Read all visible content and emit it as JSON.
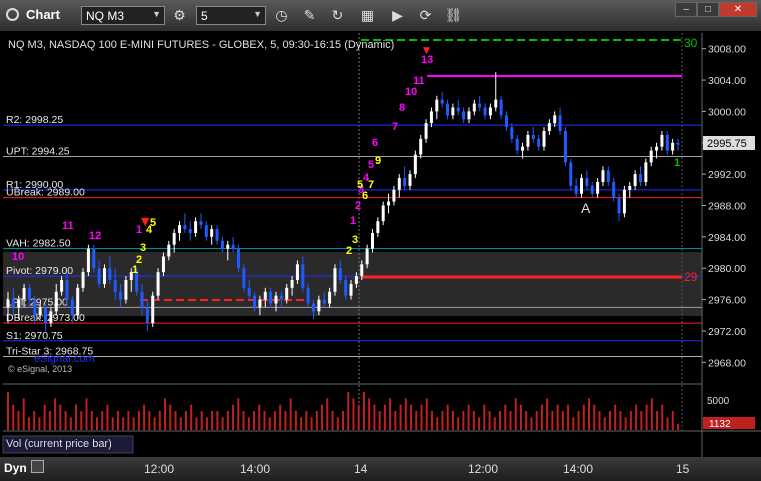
{
  "window": {
    "app_title": "Chart"
  },
  "toolbar": {
    "symbol": "NQ M3",
    "interval": "5"
  },
  "colors": {
    "magenta": "#ff00ff",
    "yellow": "#ffff00",
    "red": "#ff2020",
    "blue": "#2030ff",
    "green": "#00c000",
    "white": "#e0e0e0",
    "candle_up": "#ffffff",
    "candle_down": "#1f5bff",
    "pivot_zone": "#2a2a2a"
  },
  "chart": {
    "title": "NQ M3, NASDAQ 100 E-MINI FUTURES - GLOBEX, 5, 09:30-16:15 (Dynamic)",
    "copyright": "© eSignal, 2013",
    "watermark": "eSignal.com",
    "label_right_top": "30",
    "label_right_mid": "29",
    "letter_a": "A",
    "price_lines": [
      {
        "label": "R2: 2998.25",
        "price": 2998.25,
        "color": "#2030ff"
      },
      {
        "label": "UPT: 2994.25",
        "price": 2994.25,
        "color": "#a0a0a0"
      },
      {
        "label": "R1: 2990.00",
        "price": 2990.0,
        "color": "#2030ff"
      },
      {
        "label": "UBreak: 2989.00",
        "price": 2989.0,
        "color": "#ff2020"
      },
      {
        "label": "VAH: 2982.50",
        "price": 2982.5,
        "color": "#00a0a0"
      },
      {
        "label": "Pivot: 2979.00",
        "price": 2979.0,
        "color": "#2030ff"
      },
      {
        "label": "LPT: 2975.00",
        "price": 2975.0,
        "color": "#a0a0a0"
      },
      {
        "label": "DBreak: 2973.00",
        "price": 2973.0,
        "color": "#ff2020"
      },
      {
        "label": "S1: 2970.75",
        "price": 2970.75,
        "color": "#2030ff"
      },
      {
        "label": "Tri-Star 3: 2968.75",
        "price": 2968.75,
        "color": "#b0b0b0"
      }
    ],
    "price_axis": {
      "ticks": [
        "3008.00",
        "3004.00",
        "3000.00",
        "2996.00",
        "2992.00",
        "2988.00",
        "2984.00",
        "2980.00",
        "2976.00",
        "2972.00",
        "2968.00"
      ],
      "min": 2966,
      "max": 3010,
      "current_price": "2995.75"
    },
    "time_axis": {
      "labels": [
        "12:00",
        "14:00",
        "14",
        "12:00",
        "14:00",
        "15"
      ]
    },
    "volume_panel": {
      "label": "Vol (current price bar)",
      "axis_label": "5000",
      "current_value": "1132"
    },
    "bottom": {
      "mode": "Dyn"
    }
  },
  "chart_data": {
    "type": "candlestick",
    "title": "NQ M3, NASDAQ 100 E-MINI FUTURES - GLOBEX, 5, 09:30-16:15 (Dynamic)",
    "ylim": [
      2966,
      3010
    ],
    "series": [
      {
        "name": "price",
        "values": [
          [
            2975.0,
            2977.0,
            2973.0,
            2976.0
          ],
          [
            2976.0,
            2977.5,
            2974.0,
            2975.0
          ],
          [
            2975.0,
            2976.5,
            2973.5,
            2976.0
          ],
          [
            2976.0,
            2978.0,
            2975.0,
            2977.5
          ],
          [
            2977.5,
            2978.0,
            2975.0,
            2976.0
          ],
          [
            2976.0,
            2976.5,
            2973.0,
            2974.0
          ],
          [
            2974.0,
            2975.5,
            2973.5,
            2975.0
          ],
          [
            2975.0,
            2975.5,
            2972.0,
            2973.0
          ],
          [
            2973.0,
            2975.0,
            2972.5,
            2974.5
          ],
          [
            2974.5,
            2978.0,
            2974.0,
            2977.0
          ],
          [
            2977.0,
            2979.0,
            2976.5,
            2978.5
          ],
          [
            2978.5,
            2979.5,
            2975.0,
            2976.0
          ],
          [
            2976.0,
            2976.5,
            2973.0,
            2974.0
          ],
          [
            2974.0,
            2978.0,
            2973.5,
            2977.5
          ],
          [
            2977.5,
            2980.0,
            2977.0,
            2979.5
          ],
          [
            2979.5,
            2983.0,
            2979.0,
            2982.5
          ],
          [
            2982.5,
            2983.0,
            2979.5,
            2980.0
          ],
          [
            2980.0,
            2981.0,
            2977.5,
            2978.0
          ],
          [
            2978.0,
            2980.5,
            2977.5,
            2980.0
          ],
          [
            2980.0,
            2981.5,
            2978.0,
            2978.5
          ],
          [
            2978.5,
            2980.0,
            2976.0,
            2977.0
          ],
          [
            2977.0,
            2978.0,
            2975.0,
            2976.0
          ],
          [
            2976.0,
            2979.0,
            2975.5,
            2978.5
          ],
          [
            2978.5,
            2980.0,
            2977.0,
            2979.5
          ],
          [
            2979.5,
            2980.0,
            2976.5,
            2977.0
          ],
          [
            2977.0,
            2978.0,
            2974.0,
            2975.0
          ],
          [
            2975.0,
            2976.0,
            2972.0,
            2973.0
          ],
          [
            2973.0,
            2977.0,
            2972.5,
            2976.5
          ],
          [
            2976.5,
            2980.0,
            2976.0,
            2979.5
          ],
          [
            2979.5,
            2982.0,
            2979.0,
            2981.5
          ],
          [
            2981.5,
            2983.5,
            2981.0,
            2983.0
          ],
          [
            2983.0,
            2985.0,
            2982.0,
            2984.5
          ],
          [
            2984.5,
            2986.0,
            2983.5,
            2985.5
          ],
          [
            2985.5,
            2987.0,
            2984.5,
            2985.0
          ],
          [
            2985.0,
            2986.0,
            2983.5,
            2984.5
          ],
          [
            2984.5,
            2986.5,
            2984.0,
            2986.0
          ],
          [
            2986.0,
            2987.0,
            2985.0,
            2985.5
          ],
          [
            2985.5,
            2986.0,
            2983.5,
            2984.0
          ],
          [
            2984.0,
            2985.5,
            2983.0,
            2985.0
          ],
          [
            2985.0,
            2985.5,
            2983.0,
            2983.5
          ],
          [
            2983.5,
            2984.0,
            2982.0,
            2982.5
          ],
          [
            2982.5,
            2983.5,
            2981.0,
            2983.0
          ],
          [
            2983.0,
            2984.0,
            2982.0,
            2982.5
          ],
          [
            2982.5,
            2983.0,
            2979.5,
            2980.0
          ],
          [
            2980.0,
            2980.5,
            2977.0,
            2977.5
          ],
          [
            2977.5,
            2978.5,
            2976.0,
            2976.5
          ],
          [
            2976.5,
            2977.0,
            2974.5,
            2975.0
          ],
          [
            2975.0,
            2976.5,
            2974.0,
            2976.0
          ],
          [
            2976.0,
            2977.5,
            2975.0,
            2977.0
          ],
          [
            2977.0,
            2977.5,
            2975.0,
            2975.5
          ],
          [
            2975.5,
            2977.0,
            2974.5,
            2976.5
          ],
          [
            2976.5,
            2977.0,
            2975.0,
            2976.0
          ],
          [
            2976.0,
            2978.0,
            2975.5,
            2977.5
          ],
          [
            2977.5,
            2979.0,
            2976.5,
            2978.5
          ],
          [
            2978.5,
            2981.0,
            2978.0,
            2980.5
          ],
          [
            2980.5,
            2981.5,
            2977.0,
            2977.5
          ],
          [
            2977.5,
            2978.0,
            2975.0,
            2975.5
          ],
          [
            2975.5,
            2976.0,
            2973.5,
            2974.5
          ],
          [
            2974.5,
            2976.5,
            2974.0,
            2976.0
          ],
          [
            2976.0,
            2977.0,
            2975.0,
            2975.5
          ],
          [
            2975.5,
            2977.5,
            2975.0,
            2977.0
          ],
          [
            2977.0,
            2980.5,
            2976.5,
            2980.0
          ],
          [
            2980.0,
            2981.0,
            2978.0,
            2978.5
          ],
          [
            2978.5,
            2979.0,
            2976.0,
            2976.5
          ],
          [
            2976.5,
            2978.5,
            2976.0,
            2978.0
          ],
          [
            2978.0,
            2979.5,
            2977.5,
            2979.0
          ],
          [
            2979.0,
            2981.0,
            2978.5,
            2980.5
          ],
          [
            2980.5,
            2983.0,
            2980.0,
            2982.5
          ],
          [
            2982.5,
            2985.0,
            2982.0,
            2984.5
          ],
          [
            2984.5,
            2986.5,
            2984.0,
            2986.0
          ],
          [
            2986.0,
            2988.5,
            2985.5,
            2988.0
          ],
          [
            2988.0,
            2989.5,
            2987.0,
            2988.5
          ],
          [
            2988.5,
            2990.5,
            2988.0,
            2990.0
          ],
          [
            2990.0,
            2992.0,
            2989.0,
            2991.5
          ],
          [
            2991.5,
            2993.0,
            2990.0,
            2990.5
          ],
          [
            2990.5,
            2992.5,
            2990.0,
            2992.0
          ],
          [
            2992.0,
            2995.0,
            2991.5,
            2994.5
          ],
          [
            2994.5,
            2997.0,
            2994.0,
            2996.5
          ],
          [
            2996.5,
            2999.0,
            2996.0,
            2998.5
          ],
          [
            2998.5,
            3000.5,
            2998.0,
            3000.0
          ],
          [
            3000.0,
            3002.0,
            2999.0,
            3001.5
          ],
          [
            3001.5,
            3002.5,
            3000.5,
            3001.0
          ],
          [
            3001.0,
            3001.5,
            2999.0,
            2999.5
          ],
          [
            2999.5,
            3001.0,
            2999.0,
            3000.5
          ],
          [
            3000.5,
            3001.5,
            2999.5,
            3000.0
          ],
          [
            3000.0,
            3000.5,
            2998.5,
            2999.0
          ],
          [
            2999.0,
            3000.5,
            2998.5,
            3000.0
          ],
          [
            3000.0,
            3001.5,
            2999.5,
            3001.0
          ],
          [
            3001.0,
            3002.0,
            3000.0,
            3000.5
          ],
          [
            3000.5,
            3001.0,
            2999.0,
            2999.5
          ],
          [
            2999.5,
            3001.0,
            2999.0,
            3000.5
          ],
          [
            3000.5,
            3005.0,
            3000.0,
            3001.5
          ],
          [
            3001.5,
            3002.0,
            2999.0,
            2999.5
          ],
          [
            2999.5,
            3000.0,
            2997.5,
            2998.0
          ],
          [
            2998.0,
            2998.5,
            2996.0,
            2996.5
          ],
          [
            2996.5,
            2997.0,
            2994.5,
            2995.0
          ],
          [
            2995.0,
            2996.0,
            2994.0,
            2995.5
          ],
          [
            2995.5,
            2997.5,
            2995.0,
            2997.0
          ],
          [
            2997.0,
            2998.0,
            2996.0,
            2996.5
          ],
          [
            2996.5,
            2997.0,
            2995.0,
            2995.5
          ],
          [
            2995.5,
            2998.0,
            2995.0,
            2997.5
          ],
          [
            2997.5,
            2999.0,
            2997.0,
            2998.5
          ],
          [
            2998.5,
            3000.0,
            2998.0,
            2999.5
          ],
          [
            2999.5,
            3000.5,
            2997.0,
            2997.5
          ],
          [
            2997.5,
            2998.0,
            2993.0,
            2993.5
          ],
          [
            2993.5,
            2994.0,
            2990.0,
            2990.5
          ],
          [
            2990.5,
            2991.5,
            2989.0,
            2989.5
          ],
          [
            2989.5,
            2992.0,
            2989.0,
            2991.5
          ],
          [
            2991.5,
            2992.5,
            2990.0,
            2990.5
          ],
          [
            2990.5,
            2991.0,
            2989.0,
            2989.5
          ],
          [
            2989.5,
            2991.5,
            2989.0,
            2991.0
          ],
          [
            2991.0,
            2993.0,
            2990.5,
            2992.5
          ],
          [
            2992.5,
            2993.0,
            2990.5,
            2991.0
          ],
          [
            2991.0,
            2991.5,
            2988.5,
            2989.0
          ],
          [
            2989.0,
            2989.5,
            2986.0,
            2987.0
          ],
          [
            2987.0,
            2990.5,
            2986.5,
            2990.0
          ],
          [
            2990.0,
            2991.0,
            2989.0,
            2990.5
          ],
          [
            2990.5,
            2992.5,
            2990.0,
            2992.0
          ],
          [
            2992.0,
            2993.0,
            2990.5,
            2991.0
          ],
          [
            2991.0,
            2994.0,
            2990.5,
            2993.5
          ],
          [
            2993.5,
            2995.5,
            2993.0,
            2995.0
          ],
          [
            2995.0,
            2996.0,
            2994.0,
            2995.5
          ],
          [
            2995.5,
            2997.5,
            2995.0,
            2997.0
          ],
          [
            2997.0,
            2997.5,
            2994.5,
            2995.0
          ],
          [
            2995.0,
            2996.5,
            2994.5,
            2996.0
          ],
          [
            2996.0,
            2996.5,
            2995.0,
            2995.75
          ]
        ]
      }
    ],
    "volume": [
      6,
      4,
      3,
      5,
      2,
      3,
      2,
      4,
      3,
      5,
      4,
      3,
      2,
      4,
      3,
      5,
      3,
      2,
      3,
      4,
      2,
      3,
      2,
      3,
      2,
      3,
      4,
      3,
      2,
      3,
      5,
      4,
      3,
      2,
      3,
      4,
      2,
      3,
      2,
      3,
      3,
      2,
      3,
      4,
      5,
      3,
      2,
      3,
      4,
      3,
      2,
      3,
      4,
      3,
      5,
      3,
      2,
      3,
      2,
      3,
      4,
      5,
      3,
      2,
      3,
      6,
      5,
      4,
      6,
      5,
      4,
      3,
      4,
      5,
      3,
      4,
      5,
      4,
      3,
      4,
      5,
      3,
      2,
      3,
      4,
      3,
      2,
      3,
      4,
      3,
      2,
      4,
      3,
      2,
      3,
      4,
      3,
      5,
      4,
      3,
      2,
      3,
      4,
      5,
      3,
      4,
      3,
      4,
      2,
      3,
      4,
      5,
      4,
      3,
      2,
      3,
      4,
      3,
      2,
      3,
      4,
      3,
      4,
      5,
      3,
      4,
      2,
      3,
      1
    ]
  }
}
